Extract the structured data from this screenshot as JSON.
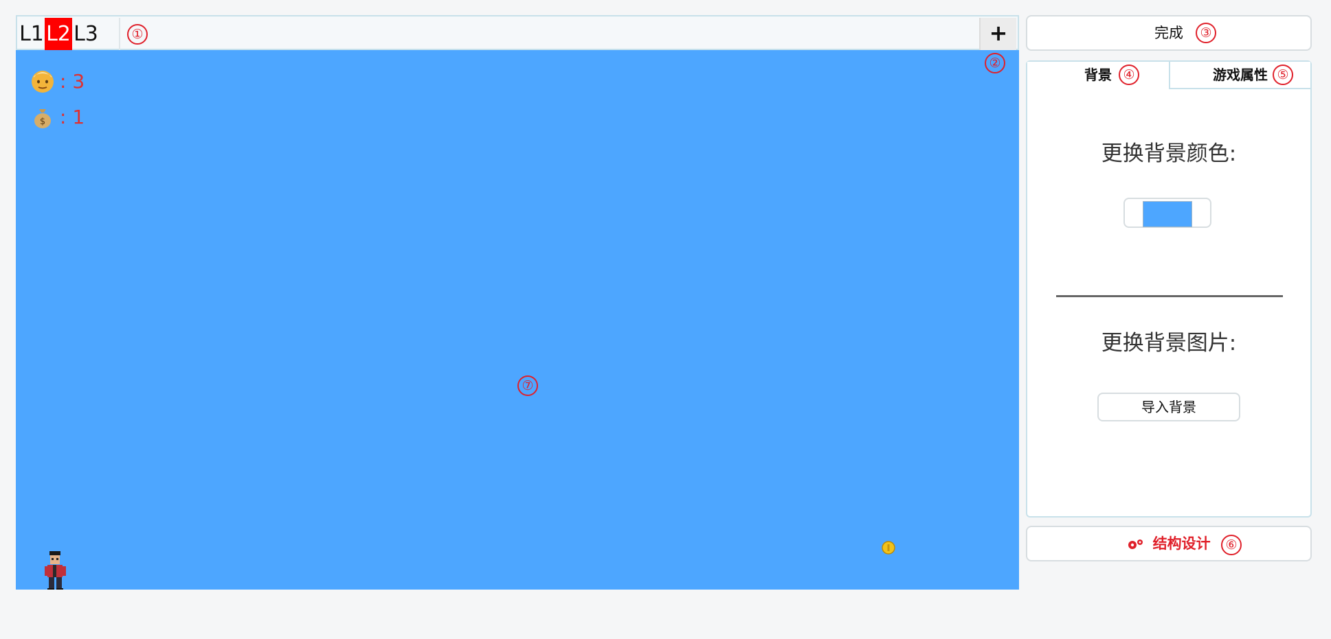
{
  "levels": {
    "tabs": [
      "L1",
      "L2",
      "L3"
    ],
    "active": "L2",
    "add_label": "+"
  },
  "hud": {
    "lives_value": ": 3",
    "coins_value": ": 1",
    "lives_icon": "face-icon",
    "coins_icon": "money-bag-icon"
  },
  "canvas": {
    "background_color": "#4da6ff"
  },
  "right_panel": {
    "done_label": "完成",
    "tabs": [
      "背景",
      "游戏属性"
    ],
    "change_color_title": "更换背景颜色:",
    "change_image_title": "更换背景图片:",
    "import_button": "导入背景",
    "structure_button": "结构设计",
    "structure_icon": "gears-icon"
  },
  "markers": [
    "①",
    "②",
    "③",
    "④",
    "⑤",
    "⑥",
    "⑦"
  ]
}
